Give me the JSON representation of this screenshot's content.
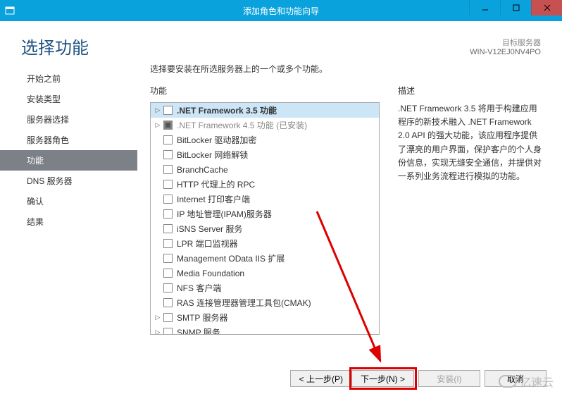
{
  "window": {
    "title": "添加角色和功能向导"
  },
  "header": {
    "title": "选择功能",
    "target_label": "目标服务器",
    "target_value": "WIN-V12EJ0NV4PO"
  },
  "sidebar": {
    "steps": [
      {
        "label": "开始之前",
        "state": "before"
      },
      {
        "label": "安装类型",
        "state": "before"
      },
      {
        "label": "服务器选择",
        "state": "before"
      },
      {
        "label": "服务器角色",
        "state": "before"
      },
      {
        "label": "功能",
        "state": "active"
      },
      {
        "label": "DNS 服务器",
        "state": "after"
      },
      {
        "label": "确认",
        "state": "after"
      },
      {
        "label": "结果",
        "state": "after"
      }
    ]
  },
  "main": {
    "instruction": "选择要安装在所选服务器上的一个或多个功能。",
    "features_heading": "功能",
    "description_heading": "描述",
    "description_text": ".NET Framework 3.5 将用于构建应用程序的新技术融入 .NET Framework 2.0 API 的强大功能，该应用程序提供了漂亮的用户界面，保护客户的个人身份信息，实现无缝安全通信，并提供对一系列业务流程进行模拟的功能。",
    "features": [
      {
        "label": ".NET Framework 3.5 功能",
        "exp": true,
        "selected": true,
        "sel_item": true
      },
      {
        "label": ".NET Framework 4.5 功能 (已安装)",
        "exp": true,
        "disabled": true,
        "filled": true
      },
      {
        "label": "BitLocker 驱动器加密"
      },
      {
        "label": "BitLocker 网络解锁"
      },
      {
        "label": "BranchCache"
      },
      {
        "label": "HTTP 代理上的 RPC"
      },
      {
        "label": "Internet 打印客户端"
      },
      {
        "label": "IP 地址管理(IPAM)服务器"
      },
      {
        "label": "iSNS Server 服务"
      },
      {
        "label": "LPR 端口监视器"
      },
      {
        "label": "Management OData IIS 扩展"
      },
      {
        "label": "Media Foundation"
      },
      {
        "label": "NFS 客户端"
      },
      {
        "label": "RAS 连接管理器管理工具包(CMAK)"
      },
      {
        "label": "SMTP 服务器",
        "exp": true
      },
      {
        "label": "SNMP 服务",
        "exp": true
      }
    ]
  },
  "footer": {
    "prev": "< 上一步(P)",
    "next": "下一步(N) >",
    "install": "安装(I)",
    "cancel": "取消"
  },
  "watermark": "亿速云"
}
